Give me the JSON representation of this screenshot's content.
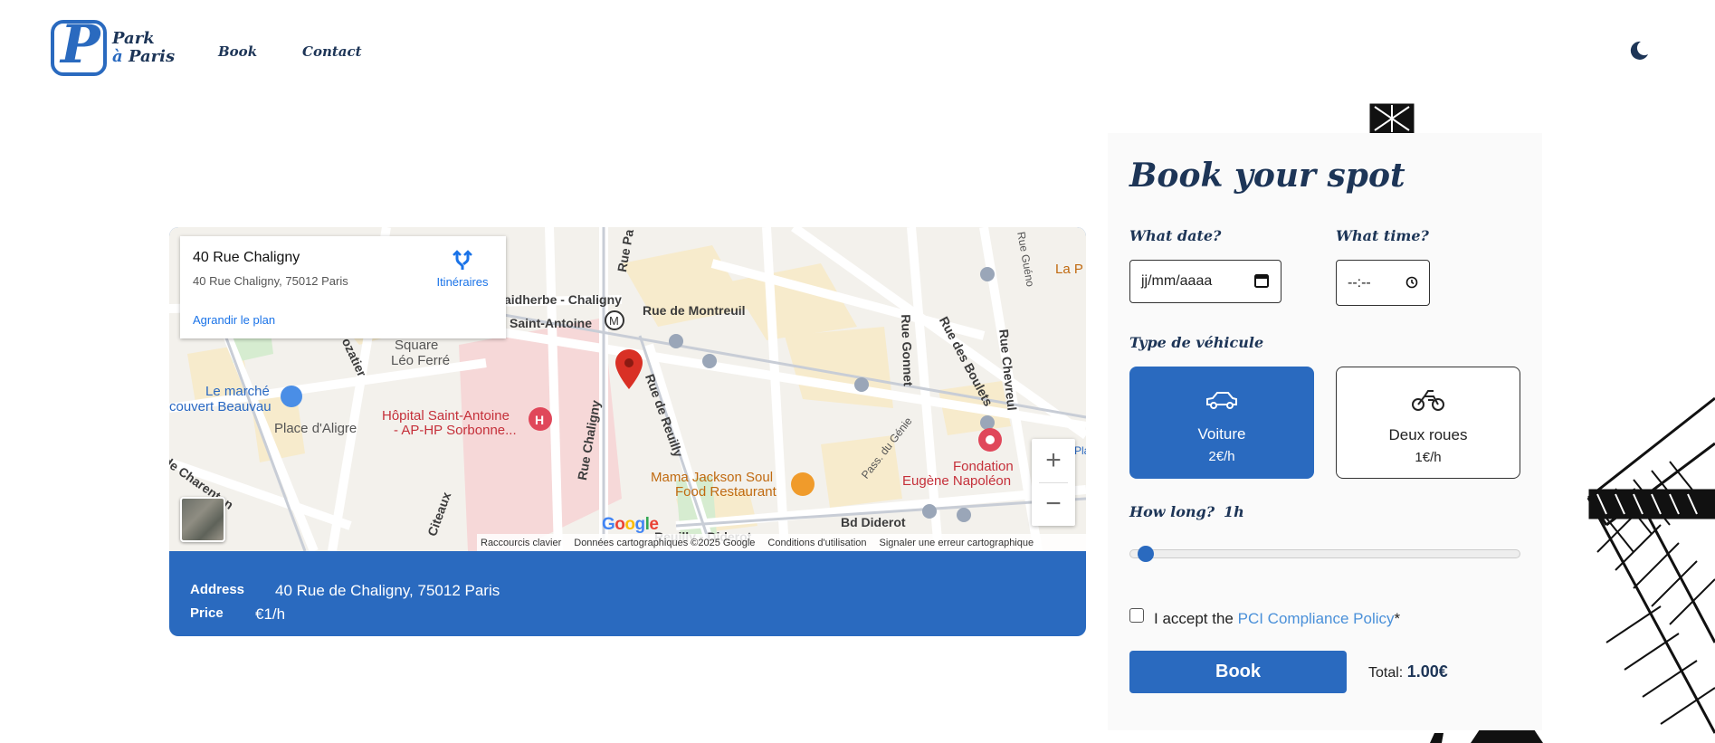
{
  "brand": {
    "line1": "Park",
    "line2_a": "à",
    "line2_b": "Paris"
  },
  "nav": {
    "book": "Book",
    "contact": "Contact"
  },
  "map": {
    "info": {
      "title": "40 Rue Chaligny",
      "subtitle": "40 Rue Chaligny, 75012 Paris",
      "route_label": "Itinéraires",
      "enlarge_link": "Agrandir le plan"
    },
    "labels": {
      "faidherbe": "aidherbe - Chaligny",
      "st_antoine": "Saint-Antoine",
      "montreuil": "Rue de Montreuil",
      "square": "Square",
      "leo": "Léo Ferré",
      "marche1": "Le marché",
      "marche2": "couvert Beauvau",
      "aligre": "Place d'Aligre",
      "hopital1": "Hôpital Saint-Antoine",
      "hopital2": "- AP-HP Sorbonne...",
      "chaligny": "Rue Chaligny",
      "reuilly": "Rue de Reuilly",
      "mama1": "Mama Jackson Soul",
      "mama2": "Food Restaurant",
      "fondation1": "Fondation",
      "fondation2": "Eugène Napoléon",
      "gonnet": "Rue Gonnet",
      "boulets": "Rue des Boulets",
      "chevreul": "Rue Chevreul",
      "passdugenie": "Pass. du Génie",
      "bd_diderot": "Bd Diderot",
      "reuilly_diderot": "Reuilly - Diderot",
      "charenton": "de Charenton",
      "citeaux": "Citeaux",
      "la_p": "La P",
      "pla": "Pla",
      "rue_gueno": "Rue Guéno",
      "rue_pa": "Rue Pa",
      "rue_crozatier": "rozatier"
    },
    "google": "Google",
    "attribution": [
      "Raccourcis clavier",
      "Données cartographiques ©2025 Google",
      "Conditions d'utilisation",
      "Signaler une erreur cartographique"
    ],
    "zoom_in": "+",
    "zoom_out": "−"
  },
  "listing": {
    "address_label": "Address",
    "address_value": "40 Rue de Chaligny, 75012 Paris",
    "price_label": "Price",
    "price_value": "€1/h"
  },
  "booking": {
    "title": "Book your spot",
    "date_label": "What date?",
    "date_placeholder": "jj/mm/aaaa",
    "time_label": "What time?",
    "time_placeholder": "--:--",
    "vehicle_label": "Type de véhicule",
    "vehicles": [
      {
        "name": "Voiture",
        "price": "2€/h",
        "icon": "car-icon",
        "selected": true
      },
      {
        "name": "Deux roues",
        "price": "1€/h",
        "icon": "motorcycle-icon",
        "selected": false
      }
    ],
    "duration_label": "How long?",
    "duration_value": "1h",
    "duration_slider_fraction": 0.02,
    "accept_prefix": "I accept the",
    "accept_link": "PCI Compliance Policy",
    "accept_suffix": "*",
    "book_button": "Book",
    "total_label": "Total:",
    "total_value": "1.00€"
  },
  "colors": {
    "primary": "#2a6abf",
    "navy": "#1d3557"
  }
}
